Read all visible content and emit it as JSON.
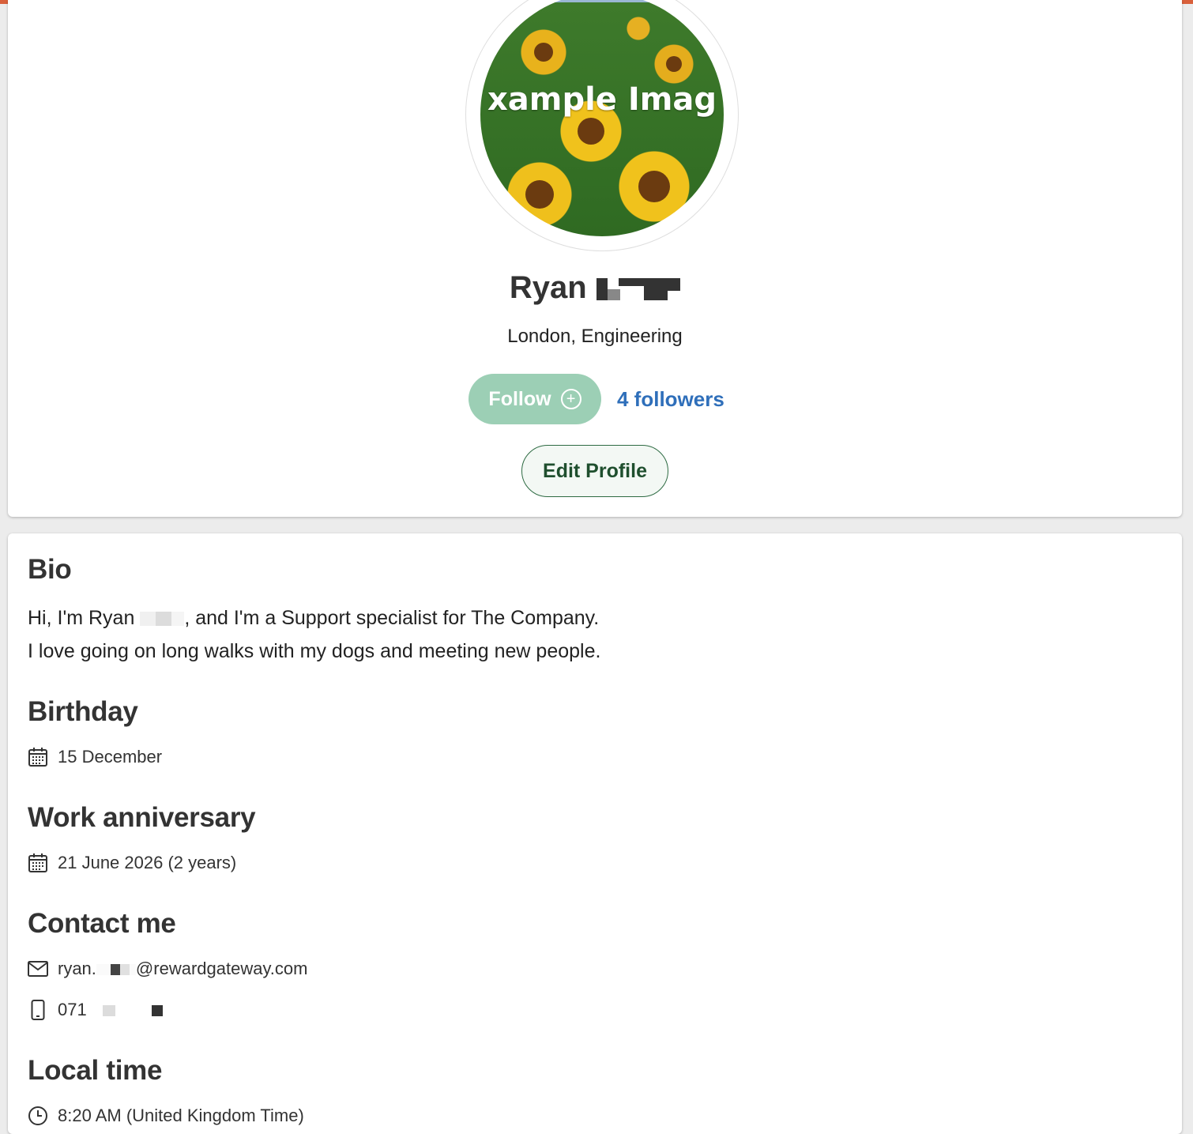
{
  "profile": {
    "avatar_text": "xample Imag",
    "first_name": "Ryan",
    "subtitle": "London, Engineering",
    "follow_label": "Follow",
    "followers_label": "4 followers",
    "edit_label": "Edit Profile"
  },
  "bio": {
    "heading": "Bio",
    "line1_prefix": "Hi, I'm Ryan ",
    "line1_suffix": ", and I'm a Support specialist for The Company.",
    "line2": "I love going on long walks with my dogs and meeting new people."
  },
  "birthday": {
    "heading": "Birthday",
    "value": "15 December",
    "icon": "calendar-icon"
  },
  "work_anniversary": {
    "heading": "Work anniversary",
    "value": "21 June 2026 (2 years)",
    "icon": "calendar-icon"
  },
  "contact": {
    "heading": "Contact me",
    "email_prefix": "ryan.",
    "email_suffix": "@rewardgateway.com",
    "phone_prefix": "071",
    "email_icon": "mail-icon",
    "phone_icon": "phone-icon"
  },
  "local_time": {
    "heading": "Local time",
    "value": "8:20 AM (United Kingdom Time)",
    "icon": "clock-icon"
  },
  "colors": {
    "accent": "#d9603b",
    "follow_button": "#9ccfb5",
    "followers_link": "#2f6fba",
    "edit_border": "#2e6b43"
  }
}
